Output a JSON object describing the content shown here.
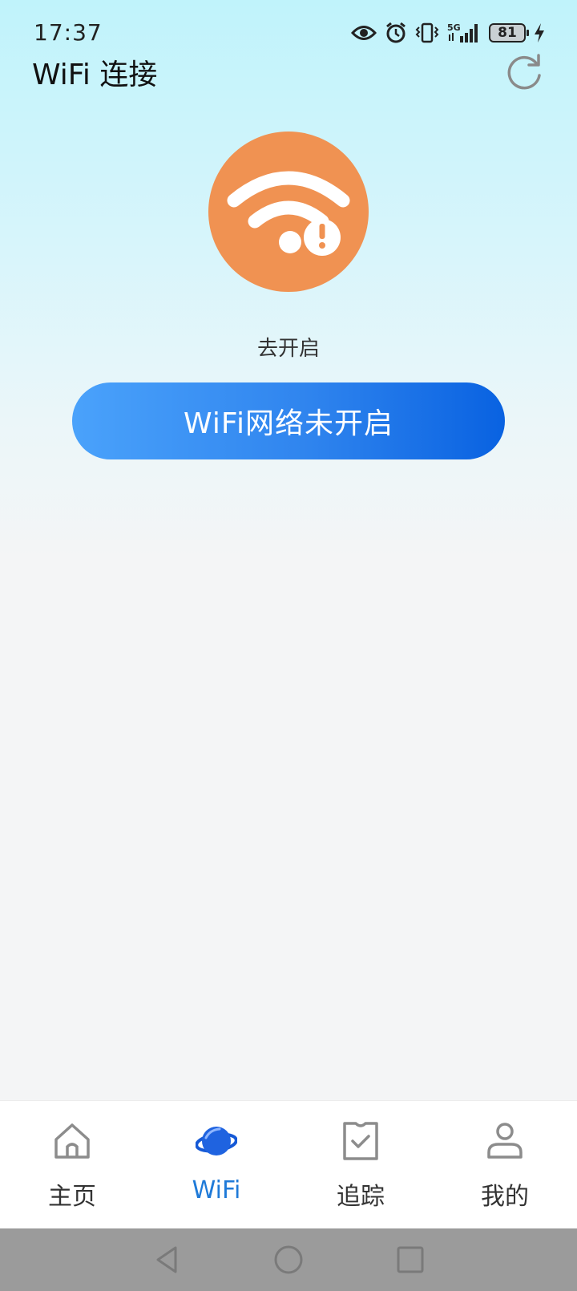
{
  "status_bar": {
    "time": "17:37",
    "network": "5G",
    "battery": "81",
    "icons": [
      "eye-icon",
      "alarm-icon",
      "vibrate-icon",
      "signal-icon",
      "battery-icon",
      "charging-icon"
    ]
  },
  "header": {
    "title": "WiFi 连接",
    "refresh_icon": "refresh-icon"
  },
  "main": {
    "status_icon": "wifi-warning-icon",
    "enable_label": "去开启",
    "status_button_label": "WiFi网络未开启"
  },
  "bottom_nav": {
    "items": [
      {
        "label": "主页",
        "icon": "home-icon"
      },
      {
        "label": "WiFi",
        "icon": "planet-icon",
        "active": true
      },
      {
        "label": "追踪",
        "icon": "tracking-icon"
      },
      {
        "label": "我的",
        "icon": "profile-icon"
      }
    ]
  },
  "system_nav": {
    "icons": [
      "back-icon",
      "home-circle-icon",
      "recents-icon"
    ]
  },
  "colors": {
    "accent": "#1f7ad8",
    "warning_circle": "#f09252",
    "button_start": "#4aa2fb",
    "button_end": "#0962e1"
  }
}
